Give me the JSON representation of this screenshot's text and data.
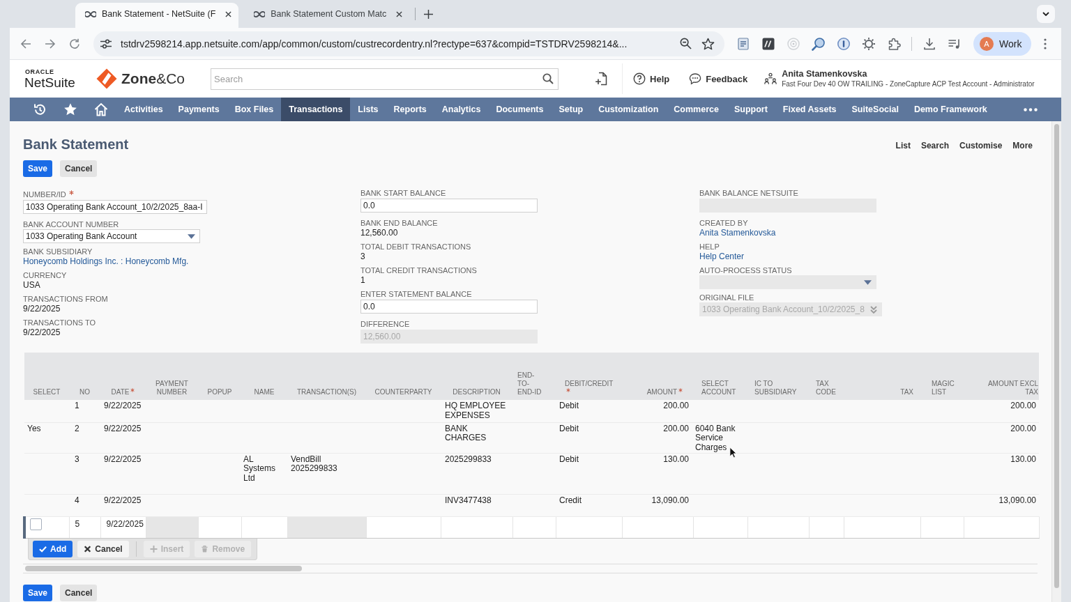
{
  "browser": {
    "tabs": [
      {
        "title": "Bank Statement - NetSuite (F",
        "selected": true
      },
      {
        "title": "Bank Statement Custom Matc",
        "selected": false
      }
    ],
    "address": "tstdrv2598214.app.netsuite.com/app/common/custom/custrecordentry.nl?rectype=637&compid=TSTDRV2598214&...",
    "profile": {
      "initial": "A",
      "label": "Work"
    }
  },
  "header": {
    "logo": {
      "top": "ORACLE",
      "bottom": "NetSuite"
    },
    "brand": "**Zone**&Co",
    "search": {
      "placeholder": "Search"
    },
    "links": [
      {
        "label": "Help",
        "kind": "help"
      },
      {
        "label": "Feedback",
        "kind": "feedback"
      }
    ],
    "user": {
      "name": "Anita Stamenkovska",
      "role": "Fast Four Dev 40 OW TRAILING - ZoneCapture ACP Test Account - Administrator"
    }
  },
  "nav": [
    {
      "label": "Activities",
      "selected": false
    },
    {
      "label": "Payments",
      "selected": false
    },
    {
      "label": "Box Files",
      "selected": false
    },
    {
      "label": "Transactions",
      "selected": true
    },
    {
      "label": "Lists",
      "selected": false
    },
    {
      "label": "Reports",
      "selected": false
    },
    {
      "label": "Analytics",
      "selected": false
    },
    {
      "label": "Documents",
      "selected": false
    },
    {
      "label": "Setup",
      "selected": false
    },
    {
      "label": "Customization",
      "selected": false
    },
    {
      "label": "Commerce",
      "selected": false
    },
    {
      "label": "Support",
      "selected": false
    },
    {
      "label": "Fixed Assets",
      "selected": false
    },
    {
      "label": "SuiteSocial",
      "selected": false
    },
    {
      "label": "Demo Framework",
      "selected": false
    }
  ],
  "page": {
    "title": "Bank Statement",
    "links": [
      "List",
      "Search",
      "Customise",
      "More"
    ],
    "top_buttons": [
      {
        "label": "Save",
        "kind": "save"
      },
      {
        "label": "Cancel",
        "kind": "cancel"
      }
    ]
  },
  "form": {
    "columns": [
      [
        {
          "label": "NUMBER/ID",
          "required": true,
          "kind": "input",
          "disabled": false,
          "value": "1033 Operating Bank Account_10/2/2025_8aa-I"
        },
        {
          "label": "BANK ACCOUNT NUMBER",
          "required": false,
          "kind": "select",
          "disabled": false,
          "value": "1033 Operating Bank Account"
        },
        {
          "label": "BANK SUBSIDIARY",
          "required": false,
          "kind": "link",
          "value": "Honeycomb Holdings Inc. : Honeycomb Mfg."
        },
        {
          "label": "CURRENCY",
          "required": false,
          "kind": "text",
          "value": "USA"
        },
        {
          "label": "TRANSACTIONS FROM",
          "required": false,
          "kind": "text",
          "value": "9/22/2025"
        },
        {
          "label": "TRANSACTIONS TO",
          "required": false,
          "kind": "text",
          "value": "9/22/2025"
        }
      ],
      [
        {
          "label": "BANK START BALANCE",
          "required": false,
          "kind": "input",
          "disabled": false,
          "value": "0.0"
        },
        {
          "label": "BANK END BALANCE",
          "required": false,
          "kind": "text",
          "value": "12,560.00"
        },
        {
          "label": "TOTAL DEBIT TRANSACTIONS",
          "required": false,
          "kind": "text",
          "value": "3"
        },
        {
          "label": "TOTAL CREDIT TRANSACTIONS",
          "required": false,
          "kind": "text",
          "value": "1"
        },
        {
          "label": "ENTER STATEMENT BALANCE",
          "required": false,
          "kind": "input",
          "disabled": false,
          "value": "0.0"
        },
        {
          "label": "DIFFERENCE",
          "required": false,
          "kind": "input",
          "disabled": true,
          "value": "12,560.00"
        }
      ],
      [
        {
          "label": "BANK BALANCE NETSUITE",
          "required": false,
          "kind": "input",
          "disabled": true
        },
        {
          "label": "CREATED BY",
          "required": false,
          "kind": "link",
          "value": "Anita Stamenkovska"
        },
        {
          "label": "HELP",
          "required": false,
          "kind": "link",
          "value": "Help Center"
        },
        {
          "label": "AUTO-PROCESS STATUS",
          "required": false,
          "kind": "select",
          "disabled": true
        },
        {
          "label": "ORIGINAL FILE",
          "required": false,
          "kind": "popup",
          "disabled": true,
          "value": "1033 Operating Bank Account_10/2/2025_8"
        }
      ]
    ]
  },
  "table": {
    "columns": [
      {
        "label": "SELECT",
        "required": false
      },
      {
        "label": "NO",
        "required": false
      },
      {
        "label": "DATE",
        "required": true
      },
      {
        "label": "PAYMENT NUMBER",
        "required": false
      },
      {
        "label": "POPUP",
        "required": false
      },
      {
        "label": "NAME",
        "required": false
      },
      {
        "label": "TRANSACTION(S)",
        "required": false
      },
      {
        "label": "COUNTERPARTY",
        "required": false
      },
      {
        "label": "DESCRIPTION",
        "required": false
      },
      {
        "label": "END-TO-END-ID",
        "required": false
      },
      {
        "label": "DEBIT/CREDIT",
        "required": true
      },
      {
        "label": "AMOUNT",
        "required": true
      },
      {
        "label": "SELECT ACCOUNT",
        "required": false
      },
      {
        "label": "IC TO SUBSIDIARY",
        "required": false
      },
      {
        "label": "TAX CODE",
        "required": false
      },
      {
        "label": "TAX",
        "required": false
      },
      {
        "label": "MAGIC LIST",
        "required": false
      },
      {
        "label": "AMOUNT EXCL TAX",
        "required": false
      }
    ],
    "rows": [
      {
        "no": "1",
        "date": "9/22/2025",
        "description": "HQ EMPLOYEE EXPENSES",
        "debit_credit": "Debit",
        "amount": "200.00",
        "amount_excl_tax": "200.00"
      },
      {
        "select": "Yes",
        "no": "2",
        "date": "9/22/2025",
        "description": "BANK CHARGES",
        "debit_credit": "Debit",
        "amount": "200.00",
        "select_account": "6040 Bank Service Charges",
        "amount_excl_tax": "200.00"
      },
      {
        "no": "3",
        "date": "9/22/2025",
        "name": "AL Systems Ltd",
        "transactions": "VendBill 2025299833",
        "description": "2025299833",
        "debit_credit": "Debit",
        "amount": "130.00",
        "amount_excl_tax": "130.00"
      },
      {
        "no": "4",
        "date": "9/22/2025",
        "description": "INV3477438",
        "debit_credit": "Credit",
        "amount": "13,090.00",
        "amount_excl_tax": "13,090.00"
      }
    ],
    "edit_row": {
      "cells": [
        {
          "kind": "checkbox",
          "checked": false
        },
        {
          "kind": "text",
          "value": "5"
        },
        {
          "kind": "text",
          "value": "9/22/2025"
        },
        {
          "kind": "field",
          "disabled": true
        },
        {
          "kind": "field",
          "disabled": false
        },
        {
          "kind": "field",
          "disabled": false
        },
        {
          "kind": "field",
          "disabled": true
        },
        {
          "kind": "field",
          "disabled": false
        },
        {
          "kind": "field",
          "disabled": false
        },
        {
          "kind": "field",
          "disabled": false
        },
        {
          "kind": "field",
          "disabled": false
        },
        {
          "kind": "field",
          "disabled": false
        },
        {
          "kind": "field",
          "disabled": false
        },
        {
          "kind": "field",
          "disabled": false
        },
        {
          "kind": "field",
          "disabled": false
        },
        {
          "kind": "field",
          "disabled": false
        },
        {
          "kind": "field",
          "disabled": false
        },
        {
          "kind": "field",
          "disabled": false
        }
      ]
    },
    "line_buttons": [
      {
        "label": "Add",
        "kind": "add",
        "disabled": false
      },
      {
        "label": "Cancel",
        "kind": "cancel",
        "disabled": false
      },
      {
        "label": "Insert",
        "kind": "insert",
        "disabled": true
      },
      {
        "label": "Remove",
        "kind": "remove",
        "disabled": true
      }
    ]
  },
  "footer_buttons": [
    {
      "label": "Save",
      "kind": "save"
    },
    {
      "label": "Cancel",
      "kind": "cancel"
    }
  ]
}
